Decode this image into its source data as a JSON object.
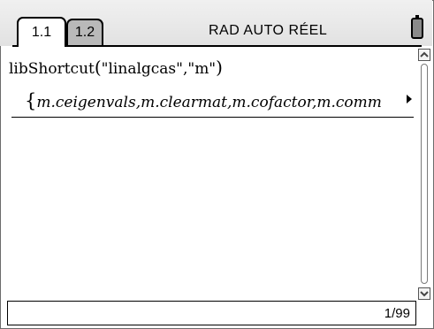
{
  "tabs": [
    {
      "label": "1.1",
      "active": true
    },
    {
      "label": "1.2",
      "active": false
    }
  ],
  "status": {
    "mode": "RAD AUTO RÉEL",
    "page_indicator": "1/99"
  },
  "entry": {
    "function_name": "libShortcut",
    "args": "\"linalgcas\",\"m\"",
    "result": "m.ceigenvals,m.clearmat,m.cofactor,m.comm"
  },
  "icons": {
    "battery": "battery-icon",
    "more": "right-arrow-icon",
    "scroll_up": "up-arrow-icon",
    "scroll_down": "down-arrow-icon"
  },
  "colors": {
    "inactive_tab": "#b9b9b9",
    "battery_fill": "#8a8a8a"
  }
}
